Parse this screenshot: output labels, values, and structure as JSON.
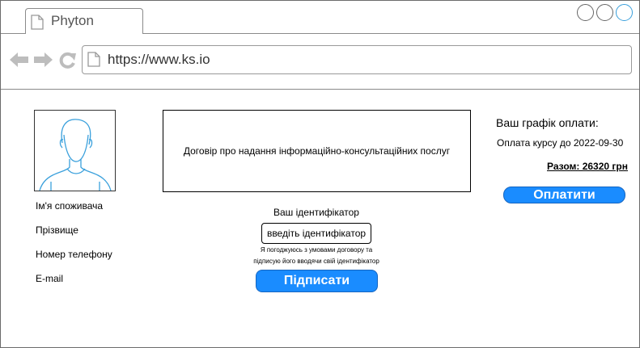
{
  "browser": {
    "tab_title": "Phyton",
    "url": "https://www.ks.io"
  },
  "profile": {
    "avatar_icon": "user-avatar-icon",
    "fields": [
      "Ім'я споживача",
      "Прізвище",
      "Номер телефону",
      "E-mail"
    ]
  },
  "contract": {
    "title": "Договір про надання інформаційно-консультаційних послуг"
  },
  "identifier": {
    "label": "Ваш ідентифікатор",
    "placeholder": "введіть ідентифікатор",
    "agree_line1": "Я погоджуюсь з умовами договору та",
    "agree_line2": "підписую його вводячи свій ідентифікатор",
    "sign_button": "Підписати"
  },
  "payment": {
    "schedule_title": "Ваш графік оплати:",
    "course_due": "Оплата курсу до 2022-09-30",
    "total": "Разом: 26320 грн",
    "pay_button": "Оплатити"
  },
  "colors": {
    "accent": "#1a8cff",
    "avatar_line": "#3aa0dc",
    "window_control_active": "#3aa0dc"
  }
}
